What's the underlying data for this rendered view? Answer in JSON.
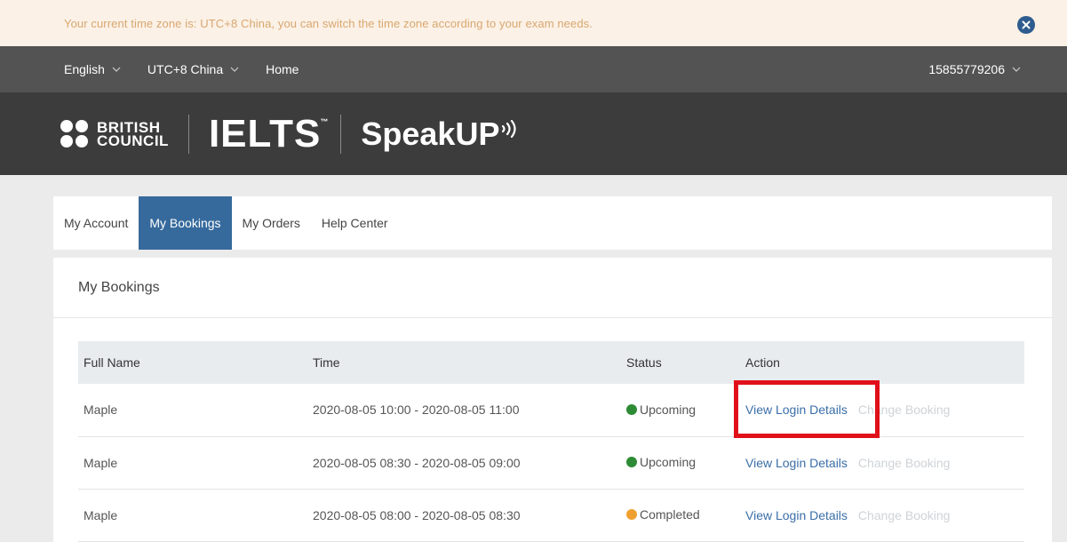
{
  "notice": {
    "text": "Your current time zone is: UTC+8 China, you can switch the time zone according to your exam needs."
  },
  "nav": {
    "language": "English",
    "timezone": "UTC+8 China",
    "home": "Home",
    "user": "15855779206"
  },
  "brand": {
    "bc_line1": "BRITISH",
    "bc_line2": "COUNCIL",
    "ielts": "IELTS",
    "ielts_tm": "™",
    "speakup": "SpeakUP"
  },
  "tabs": [
    {
      "label": "My Account"
    },
    {
      "label": "My Bookings"
    },
    {
      "label": "My Orders"
    },
    {
      "label": "Help Center"
    }
  ],
  "content": {
    "title": "My Bookings",
    "headers": {
      "name": "Full Name",
      "time": "Time",
      "status": "Status",
      "action": "Action"
    },
    "rows": [
      {
        "name": "Maple",
        "time": "2020-08-05 10:00 - 2020-08-05 11:00",
        "status": "Upcoming",
        "view": "View Login Details",
        "change": "Change Booking"
      },
      {
        "name": "Maple",
        "time": "2020-08-05 08:30 - 2020-08-05 09:00",
        "status": "Upcoming",
        "view": "View Login Details",
        "change": "Change Booking"
      },
      {
        "name": "Maple",
        "time": "2020-08-05 08:00 - 2020-08-05 08:30",
        "status": "Completed",
        "view": "View Login Details",
        "change": "Change Booking"
      }
    ]
  },
  "colors": {
    "accent": "#366a9c",
    "upcoming": "#2e8b35",
    "completed": "#f0a030",
    "highlight": "#e0101a"
  }
}
